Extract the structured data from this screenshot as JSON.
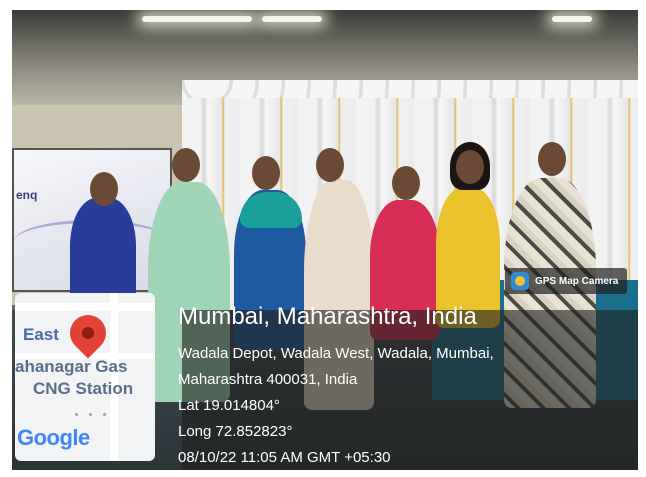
{
  "camera_badge": {
    "label": "GPS Map Camera",
    "icon": "gps-map-camera-icon"
  },
  "screen_logo": "enq",
  "map": {
    "labels": [
      "East",
      "ahanagar Gas",
      "CNG Station"
    ],
    "logo": "Google",
    "pin_icon": "map-pin-icon"
  },
  "location": {
    "city": "Mumbai, Maharashtra, India",
    "address_line1": "Wadala Depot, Wadala West, Wadala, Mumbai,",
    "address_line2": "Maharashtra 400031, India",
    "latitude": "Lat 19.014804°",
    "longitude": "Long 72.852823°",
    "timestamp": "08/10/22 11:05 AM GMT +05:30"
  },
  "colors": {
    "pin": "#e04236",
    "overlay": "#20201e",
    "badge_icon": "#2e8bd6"
  }
}
